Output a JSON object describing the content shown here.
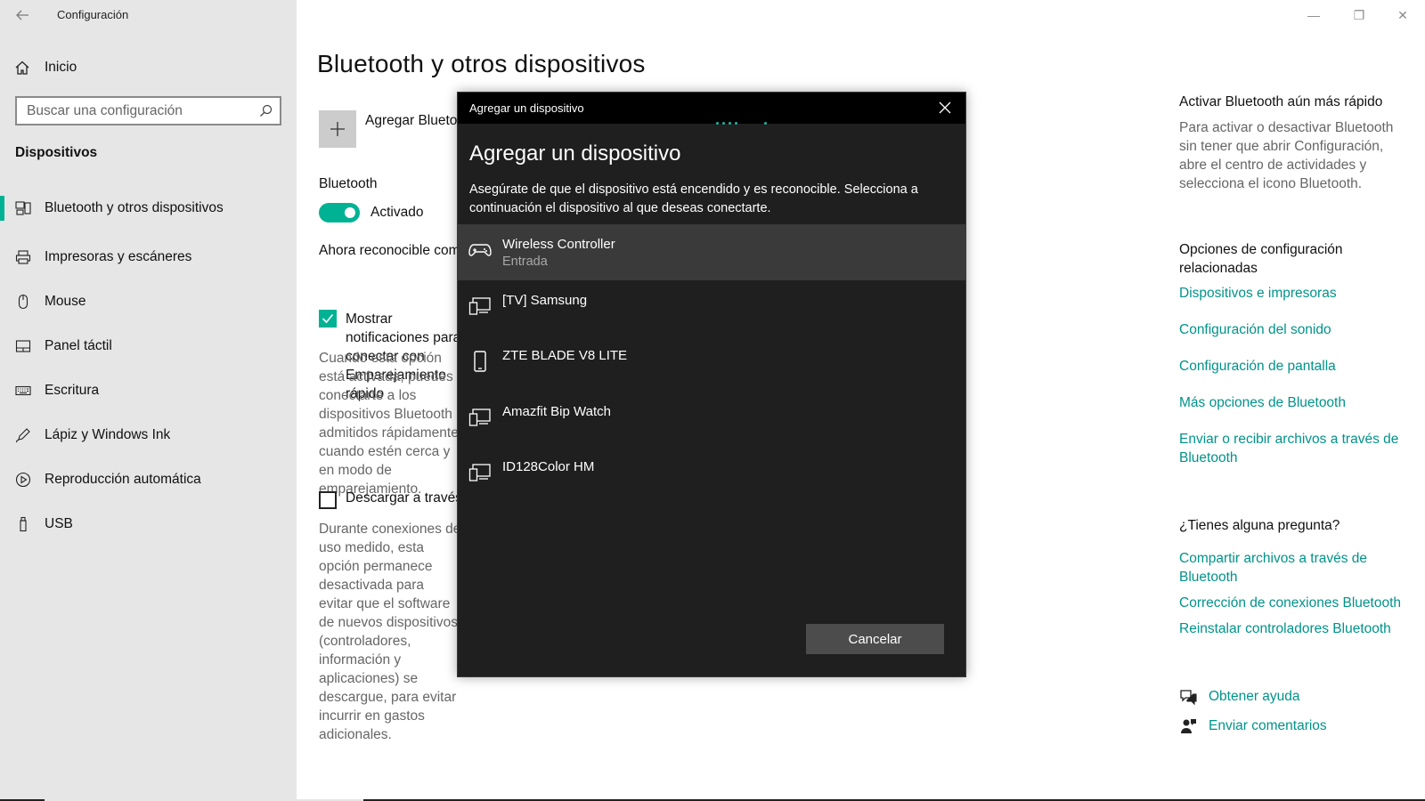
{
  "app": {
    "title": "Configuración",
    "back_icon": "back-arrow-icon"
  },
  "window_controls": {
    "minimize": "—",
    "restore": "❐",
    "close": "✕"
  },
  "sidebar": {
    "home_label": "Inicio",
    "search_placeholder": "Buscar una configuración",
    "section": "Dispositivos",
    "items": [
      {
        "label": "Bluetooth y otros dispositivos",
        "icon": "bluetooth-devices-icon",
        "active": true
      },
      {
        "label": "Impresoras y escáneres",
        "icon": "printer-icon"
      },
      {
        "label": "Mouse",
        "icon": "mouse-icon"
      },
      {
        "label": "Panel táctil",
        "icon": "touchpad-icon"
      },
      {
        "label": "Escritura",
        "icon": "keyboard-icon"
      },
      {
        "label": "Lápiz y Windows Ink",
        "icon": "pen-icon"
      },
      {
        "label": "Reproducción automática",
        "icon": "autoplay-icon"
      },
      {
        "label": "USB",
        "icon": "usb-icon"
      }
    ]
  },
  "main": {
    "title": "Bluetooth y otros dispositivos",
    "add_label": "Agregar Bluetooth u otro dispositivo",
    "bluetooth_label": "Bluetooth",
    "toggle_state": "Activado",
    "discoverable": "Ahora reconocible como",
    "show_notifications_label": "Mostrar notificaciones para conectar con Emparejamiento rápido",
    "show_notifications_desc": "Cuando esta opción está activada, puedes conectarte a los dispositivos Bluetooth admitidos rápidamente cuando estén cerca y en modo de emparejamiento.",
    "metered_label": "Descargar a través de conexiones de uso medido",
    "metered_desc": "Durante conexiones de uso medido, esta opción permanece desactivada para evitar que el software de nuevos dispositivos (controladores, información y aplicaciones) se descargue, para evitar incurrir en gastos adicionales."
  },
  "right": {
    "fast_title": "Activar Bluetooth aún más rápido",
    "fast_body": "Para activar o desactivar Bluetooth sin tener que abrir Configuración, abre el centro de actividades y selecciona el icono Bluetooth.",
    "related_title": "Opciones de configuración relacionadas",
    "related_links": [
      "Dispositivos e impresoras",
      "Configuración del sonido",
      "Configuración de pantalla",
      "Más opciones de Bluetooth",
      "Enviar o recibir archivos a través de Bluetooth"
    ],
    "question_title": "¿Tienes alguna pregunta?",
    "question_links": [
      "Compartir archivos a través de Bluetooth",
      "Corrección de conexiones Bluetooth",
      "Reinstalar controladores Bluetooth"
    ],
    "help": "Obtener ayuda",
    "feedback": "Enviar comentarios"
  },
  "dialog": {
    "titlebar": "Agregar un dispositivo",
    "heading": "Agregar un dispositivo",
    "description": "Asegúrate de que el dispositivo está encendido y es reconocible. Selecciona a continuación el dispositivo al que deseas conectarte.",
    "devices": [
      {
        "name": "Wireless Controller",
        "sub": "Entrada",
        "icon": "gamepad-icon"
      },
      {
        "name": "[TV] Samsung",
        "sub": "",
        "icon": "display-device-icon"
      },
      {
        "name": "ZTE BLADE V8 LITE",
        "sub": "",
        "icon": "phone-icon"
      },
      {
        "name": "Amazfit Bip Watch",
        "sub": "",
        "icon": "display-device-icon"
      },
      {
        "name": "ID128Color HM",
        "sub": "",
        "icon": "display-device-icon"
      }
    ],
    "cancel": "Cancelar",
    "accent": "#00b294"
  }
}
